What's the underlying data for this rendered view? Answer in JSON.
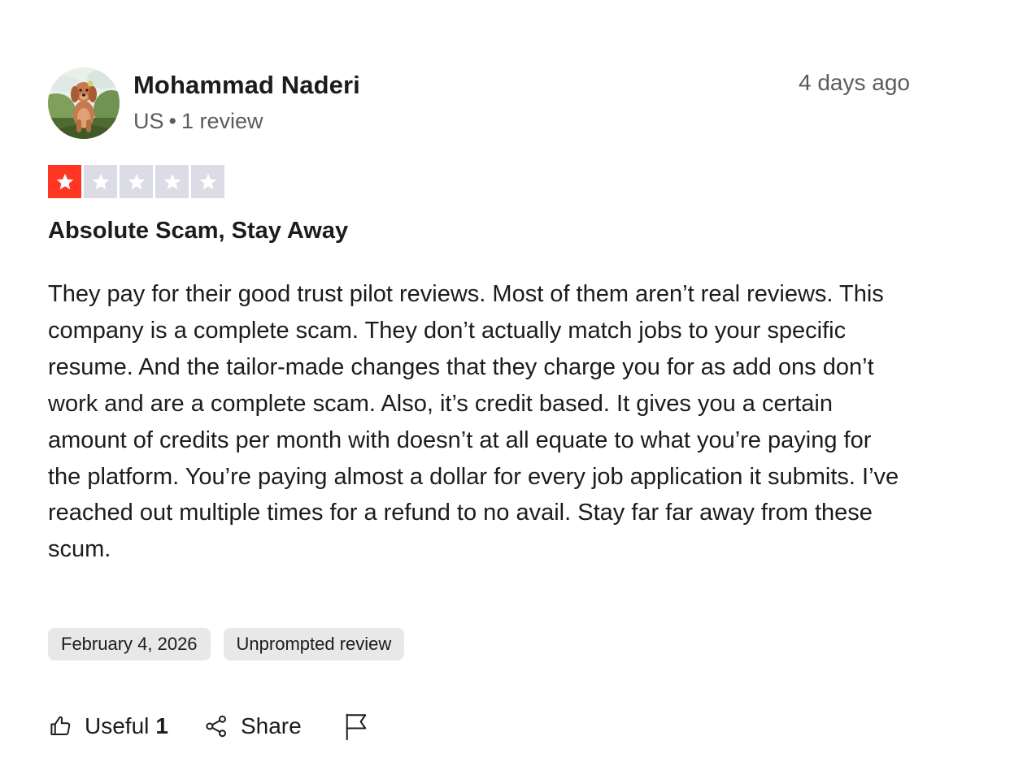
{
  "reviewer": {
    "name": "Mohammad Naderi",
    "country": "US",
    "separator": "•",
    "review_count": "1 review"
  },
  "review": {
    "posted_ago": "4 days ago",
    "rating": 1,
    "rating_max": 5,
    "title": "Absolute Scam, Stay Away",
    "body": "They pay for their good trust pilot reviews. Most of them aren’t real reviews. This company is a complete scam. They don’t actually match jobs to your specific resume. And the tailor-made changes that they charge you for as add ons don’t work and are a complete scam. Also, it’s credit based. It gives you a certain amount of credits per month with doesn’t at all equate to what you’re paying for the platform. You’re paying almost a dollar for every job application it submits. I’ve reached out multiple times for a refund to no avail. Stay far far away from these scum.",
    "date_tag": "February 4, 2026",
    "type_tag": "Unprompted review"
  },
  "actions": {
    "useful_label": "Useful",
    "useful_count": "1",
    "share_label": "Share"
  },
  "colors": {
    "star_filled": "#ff3722",
    "star_empty": "#dcdce6",
    "tag_background": "#e8e8e8",
    "muted_text": "#5c5c5c"
  },
  "icons": {
    "avatar": "dog-avatar-icon",
    "star": "star-icon",
    "useful": "thumbs-up-icon",
    "share": "share-icon",
    "report": "flag-icon"
  }
}
